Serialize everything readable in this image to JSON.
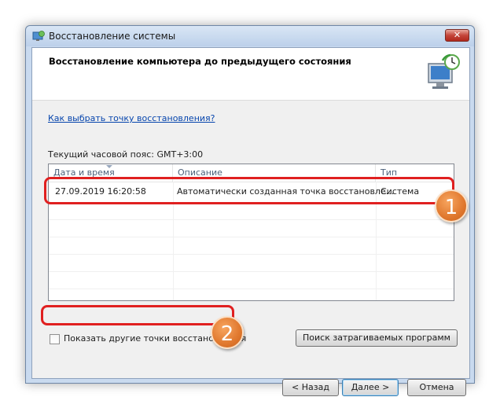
{
  "window": {
    "title": "Восстановление системы",
    "close_label": "✕"
  },
  "header": {
    "title": "Восстановление компьютера до предыдущего состояния"
  },
  "help_link": "Как выбрать точку восстановления?",
  "timezone_label": "Текущий часовой пояс: GMT+3:00",
  "table": {
    "columns": [
      "Дата и время",
      "Описание",
      "Тип"
    ],
    "rows": [
      {
        "date": "27.09.2019 16:20:58",
        "description": "Автоматически созданная точка восстановле...",
        "type": "Система"
      }
    ]
  },
  "checkbox": {
    "label": "Показать другие точки восстановления",
    "checked": false
  },
  "buttons": {
    "scan": "Поиск затрагиваемых программ",
    "back": "< Назад",
    "next": "Далее >",
    "cancel": "Отмена"
  },
  "annotations": {
    "badge1": "1",
    "badge2": "2"
  },
  "colors": {
    "annotation_red": "#e02020",
    "badge_orange": "#e0782e",
    "link_blue": "#0645ad"
  }
}
